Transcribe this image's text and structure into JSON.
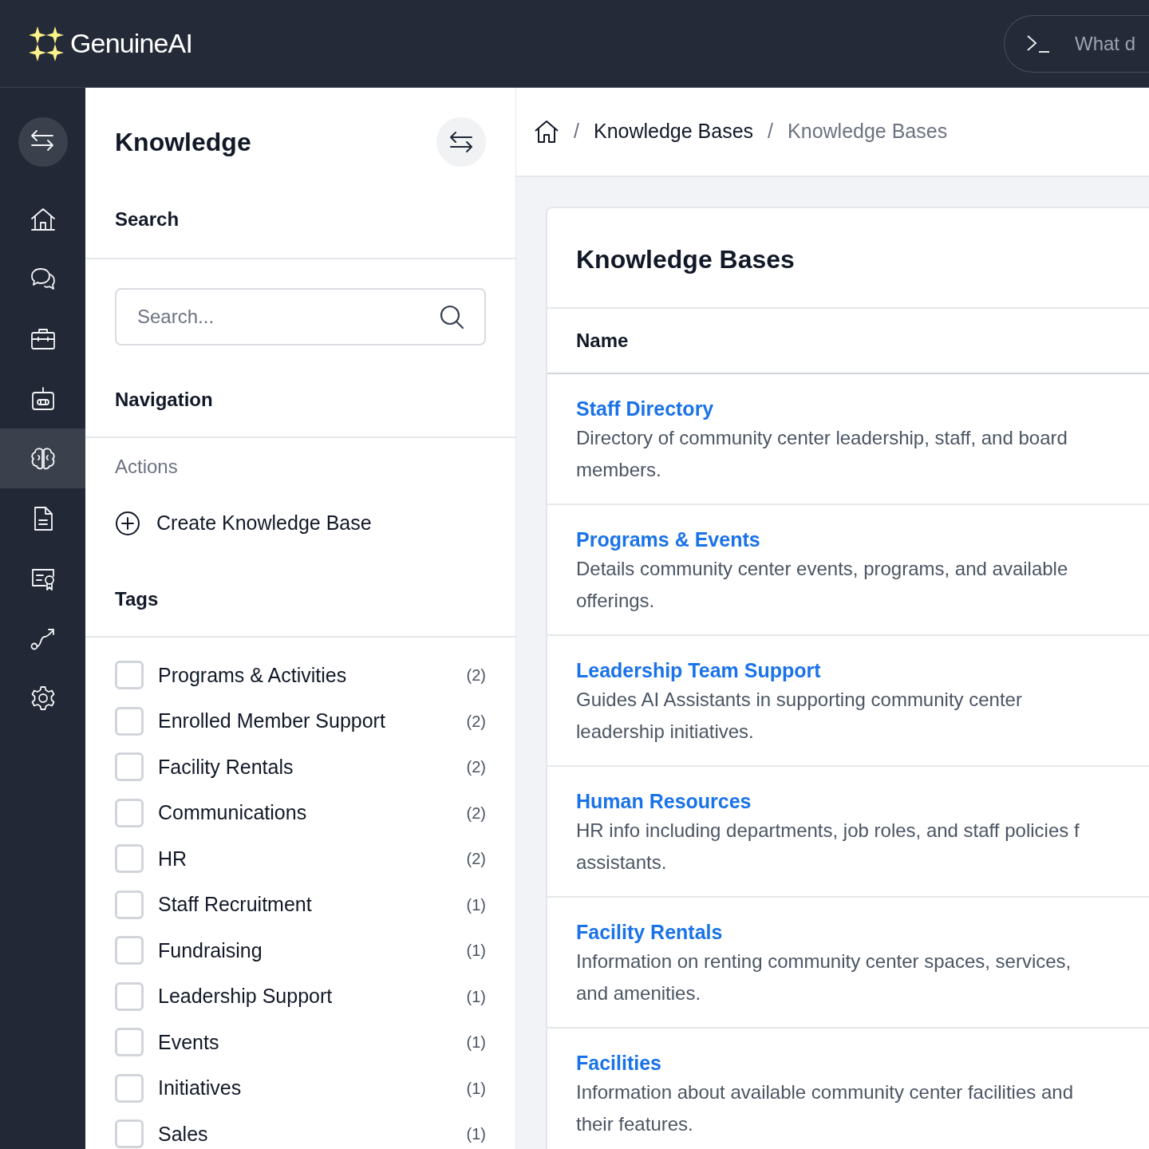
{
  "header": {
    "brand": "GenuineAI",
    "prompt": {
      "placeholder": "What d"
    }
  },
  "rail": [
    {
      "kind": "home",
      "selected": false
    },
    {
      "kind": "chat",
      "selected": false
    },
    {
      "kind": "briefcase",
      "selected": false
    },
    {
      "kind": "robot",
      "selected": false
    },
    {
      "kind": "brain",
      "selected": true
    },
    {
      "kind": "document",
      "selected": false
    },
    {
      "kind": "certificate",
      "selected": false
    },
    {
      "kind": "route",
      "selected": false
    },
    {
      "kind": "settings",
      "selected": false
    }
  ],
  "panel": {
    "title": "Knowledge",
    "search_heading": "Search",
    "search": {
      "placeholder": "Search..."
    },
    "navigation_heading": "Navigation",
    "actions_label": "Actions",
    "action": "Create Knowledge Base",
    "tags_heading": "Tags",
    "tags": [
      {
        "label": "Programs & Activities",
        "count": "(2)",
        "checked": false
      },
      {
        "label": "Enrolled Member Support",
        "count": "(2)",
        "checked": false
      },
      {
        "label": "Facility Rentals",
        "count": "(2)",
        "checked": false
      },
      {
        "label": "Communications",
        "count": "(2)",
        "checked": false
      },
      {
        "label": "HR",
        "count": "(2)",
        "checked": false
      },
      {
        "label": "Staff Recruitment",
        "count": "(1)",
        "checked": false
      },
      {
        "label": "Fundraising",
        "count": "(1)",
        "checked": false
      },
      {
        "label": "Leadership Support",
        "count": "(1)",
        "checked": false
      },
      {
        "label": "Events",
        "count": "(1)",
        "checked": false
      },
      {
        "label": "Initiatives",
        "count": "(1)",
        "checked": false
      },
      {
        "label": "Sales",
        "count": "(1)",
        "checked": false
      }
    ]
  },
  "breadcrumb": {
    "separator": "/",
    "items": [
      {
        "label": "Knowledge Bases",
        "current": false
      },
      {
        "label": "Knowledge Bases",
        "current": true
      }
    ]
  },
  "card": {
    "title": "Knowledge Bases",
    "column": "Name",
    "rows": [
      {
        "title": "Staff Directory",
        "lines": [
          "Directory of community center leadership, staff, and board",
          "members."
        ]
      },
      {
        "title": "Programs & Events",
        "lines": [
          "Details community center events, programs, and available",
          "offerings."
        ]
      },
      {
        "title": "Leadership Team Support",
        "lines": [
          "Guides AI Assistants in supporting community center",
          "leadership initiatives."
        ]
      },
      {
        "title": "Human Resources",
        "lines": [
          "HR info including departments, job roles, and staff policies f",
          "assistants."
        ]
      },
      {
        "title": "Facility Rentals",
        "lines": [
          "Information on renting community center spaces, services,",
          "and amenities."
        ]
      },
      {
        "title": "Facilities",
        "lines": [
          "Information about available community center facilities and",
          "their features."
        ]
      }
    ]
  }
}
